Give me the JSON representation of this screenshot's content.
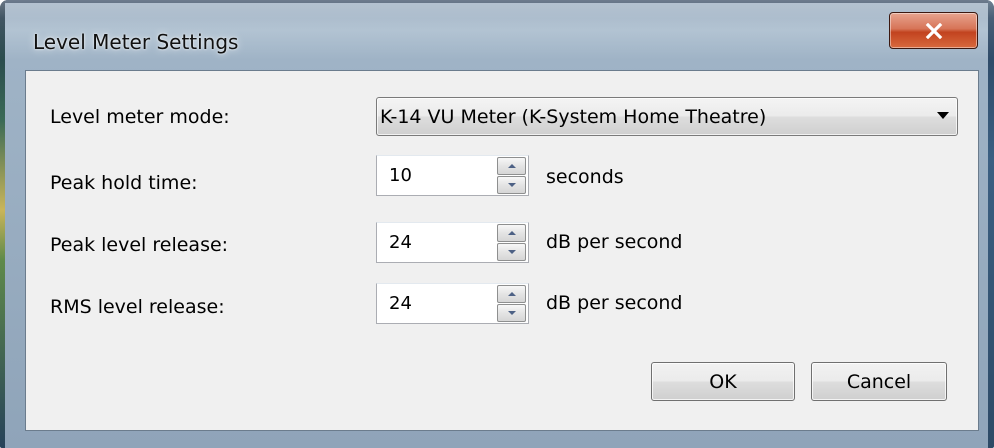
{
  "window": {
    "title": "Level Meter Settings",
    "close_icon": "close-icon",
    "close_color": "#c7452a"
  },
  "form": {
    "mode": {
      "label": "Level meter mode:",
      "value": "K-14 VU Meter (K-System Home Theatre)"
    },
    "peak_hold": {
      "label": "Peak hold time:",
      "value": "10",
      "unit": "seconds"
    },
    "peak_release": {
      "label": "Peak level release:",
      "value": "24",
      "unit": "dB per second"
    },
    "rms_release": {
      "label": "RMS level release:",
      "value": "24",
      "unit": "dB per second"
    }
  },
  "buttons": {
    "ok": "OK",
    "cancel": "Cancel"
  }
}
